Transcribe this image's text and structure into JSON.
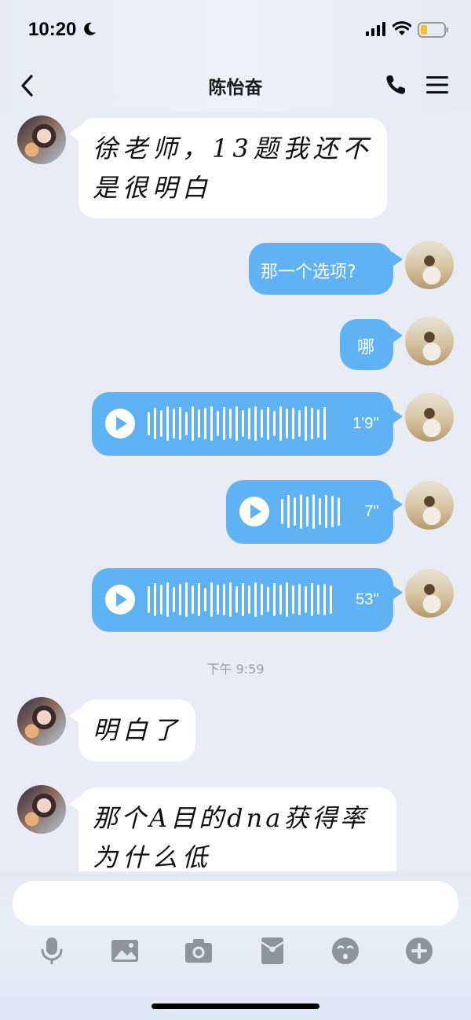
{
  "status_bar": {
    "time": "10:20",
    "icons": [
      "moon-icon",
      "signal-icon",
      "wifi-icon",
      "battery-icon"
    ]
  },
  "nav": {
    "title": "陈怡奋",
    "back_icon": "chevron-left-icon",
    "call_icon": "phone-icon",
    "menu_icon": "hamburger-menu-icon"
  },
  "messages": [
    {
      "side": "left",
      "type": "text",
      "lines": [
        "徐老师，13题我还不",
        "是很明白"
      ]
    },
    {
      "side": "right",
      "type": "text",
      "text": "那一个选项?"
    },
    {
      "side": "right",
      "type": "text",
      "text": "哪"
    },
    {
      "side": "right",
      "type": "voice",
      "duration": "1'9''"
    },
    {
      "side": "right",
      "type": "voice",
      "duration": "7''"
    },
    {
      "side": "right",
      "type": "voice",
      "duration": "53''"
    },
    {
      "type": "timestamp",
      "text": "下午 9:59"
    },
    {
      "side": "left",
      "type": "text",
      "lines": [
        "明白了"
      ]
    },
    {
      "side": "left",
      "type": "text",
      "lines": [
        "那个A目的dna获得率",
        "为什么低"
      ]
    }
  ],
  "input": {
    "placeholder": ""
  },
  "toolbar": {
    "icons": [
      "microphone-icon",
      "image-icon",
      "camera-icon",
      "red-packet-icon",
      "emoji-icon",
      "plus-icon"
    ]
  },
  "colors": {
    "accent_blue": "#5fb3f5",
    "background": "#e9ecf5",
    "bubble_white": "#ffffff"
  }
}
